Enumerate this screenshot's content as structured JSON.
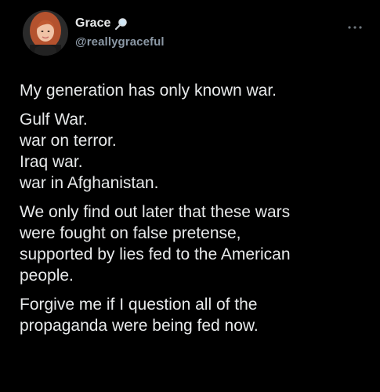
{
  "author": {
    "display_name": "Grace",
    "handle": "@reallygraceful",
    "badge_icon": "magnifying-glass-icon",
    "more_icon": "more-options-icon"
  },
  "tweet": {
    "paragraphs": [
      {
        "lines": [
          "My generation has only known war."
        ]
      },
      {
        "lines": [
          "Gulf War.",
          "war on terror.",
          "Iraq war.",
          "war in Afghanistan."
        ]
      },
      {
        "lines": [
          "We only find out later that these wars",
          "were fought on false pretense,",
          "supported by lies fed to the American",
          "people."
        ]
      },
      {
        "lines": [
          "Forgive me if I question all of the",
          "propaganda were being fed now."
        ]
      }
    ]
  },
  "colors": {
    "background": "#000000",
    "primary_text": "#e7e9ea",
    "secondary_text": "#8b98a5"
  }
}
